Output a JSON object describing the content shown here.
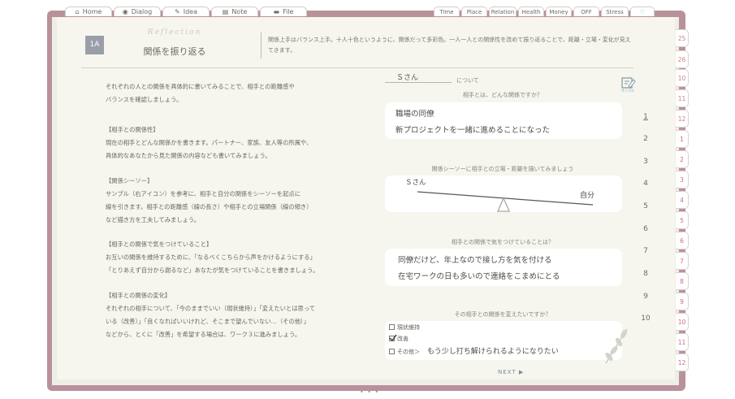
{
  "left_tabs": [
    {
      "label": "Home",
      "icon": "home-icon",
      "glyph": "⌂"
    },
    {
      "label": "Dialog",
      "icon": "dialog-icon",
      "glyph": "◉"
    },
    {
      "label": "Idea",
      "icon": "bulb-icon",
      "glyph": "✎"
    },
    {
      "label": "Note",
      "icon": "note-icon",
      "glyph": "▤"
    },
    {
      "label": "File",
      "icon": "folder-icon",
      "glyph": "▬"
    }
  ],
  "right_tabs": [
    "Time",
    "Place",
    "Relation",
    "Health",
    "Money",
    "OFF",
    "Stress"
  ],
  "heart_tab": "♡",
  "side_tabs": {
    "year_month": [
      {
        "mark": "Y",
        "num": "25"
      },
      {
        "mark": "Y",
        "num": "26"
      }
    ],
    "months_a": [
      "10",
      "11",
      "12",
      "1",
      "2",
      "3",
      "4",
      "5",
      "6",
      "7",
      "8",
      "9",
      "10",
      "11",
      "12"
    ]
  },
  "header": {
    "badge": "1A",
    "reflection": "Reflection",
    "title": "関係を振り返る",
    "description": "関係上手はバランス上手。十人十色というように、関係だって多彩色。一人一人との関係性を改めて振り返ることで、距離・立場・変化が見えてきます。"
  },
  "instructions": [
    {
      "id": "intro",
      "lines": [
        "それぞれの人との関係を具体的に書いてみることで、相手との距離感や",
        "バランスを確認しましょう。"
      ]
    },
    {
      "id": "rel",
      "lines": [
        "【相手との関係性】",
        "現在の相手とどんな関係かを書きます。パートナー、家族、友人等の所属や、",
        "具体的なあなたから見た関係の内容なども書いてみましょう。"
      ]
    },
    {
      "id": "seesaw",
      "lines": [
        "【関係シーソー】",
        "サンプル（右アイコン）を参考に、相手と自分の関係をシーソーを起点に",
        "線を引きます。相手との距離感（線の長さ）や相手との立場関係（線の傾き）",
        "など描き方を工夫してみましょう。"
      ]
    },
    {
      "id": "care",
      "lines": [
        "【相手との関係で気をつけていること】",
        "お互いの関係を維持するために、「なるべくこちらから声をかけるようにする」",
        "「とりあえず自分から謝るなど」あなたが気をつけていることを書きましょう。"
      ]
    },
    {
      "id": "change",
      "lines": [
        "【相手との関係の変化】",
        "それぞれの相手について、「今のままでいい（現状維持）」「変えたいとは思って",
        "いる（改善）」「良くなればいいけれど、そこまで望んでいない…（その他）」",
        "などから、とくに「改善」を希望する場合は、ワーク３に進みましょう。"
      ]
    }
  ],
  "form": {
    "person_name": "Ｓさん",
    "about_label": "について",
    "sample_icon": "sample-icon",
    "sample_label": "サンプル",
    "q1": "相手とは、どんな関係ですか？",
    "a1": [
      "職場の同僚",
      "新プロジェクトを一緒に進めることになった"
    ],
    "q2": "関係シーソーに相手との立場・距離を描いてみましょう",
    "seesaw_left": "Ｓさん",
    "seesaw_right": "自分",
    "q3": "相手との関係で気をつけていることは？",
    "a3": [
      "同僚だけど、年上なので接し方を気を付ける",
      "在宅ワークの日も多いので連絡をこまめにとる"
    ],
    "q4": "その相手との関係を変えたいですか？",
    "options": [
      {
        "label": "現状維持",
        "checked": false
      },
      {
        "label": "改善",
        "checked": true
      },
      {
        "label": "その他＞",
        "checked": false
      }
    ],
    "other_text": "もう少し打ち解けられるようになりたい"
  },
  "row_numbers": [
    "1",
    "2",
    "3",
    "4",
    "5",
    "6",
    "7",
    "8",
    "9",
    "10"
  ],
  "next_label": "NEXT ▶",
  "bottom_dots": "• • •"
}
